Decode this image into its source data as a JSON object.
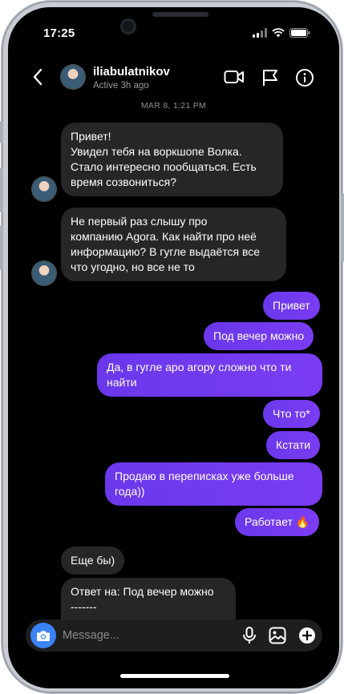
{
  "status_bar": {
    "time": "17:25"
  },
  "header": {
    "username": "iliabulatnikov",
    "activity": "Active 3h ago",
    "icons": [
      "back-icon",
      "video-call-icon",
      "flag-icon",
      "info-icon"
    ]
  },
  "date_stamp": "MAR 8, 1:21 PM",
  "messages": [
    {
      "direction": "incoming",
      "text": "Привет!\nУвидел тебя на воркшопе Волка.\nСтало интересно пообщаться. Есть\nвремя созвониться?"
    },
    {
      "direction": "incoming",
      "text": "Не первый раз слышу про\nкомпанию Agora. Как найти про неё\nинформацию? В гугле выдаётся все\nчто угодно, но все не то"
    },
    {
      "direction": "outgoing",
      "text": "Привет"
    },
    {
      "direction": "outgoing",
      "text": "Под вечер можно"
    },
    {
      "direction": "outgoing",
      "text": "Да, в гугле аро агору сложно что ти\nнайти"
    },
    {
      "direction": "outgoing",
      "text": "Что то*"
    },
    {
      "direction": "outgoing",
      "text": "Кстати"
    },
    {
      "direction": "outgoing",
      "text": "Продаю в переписках уже больше\nгода))"
    },
    {
      "direction": "outgoing",
      "text": "Работает 🔥"
    },
    {
      "direction": "incoming",
      "text": "Еще бы)"
    },
    {
      "direction": "incoming",
      "text": "Ответ на: Под вечер можно\n-------"
    }
  ],
  "composer": {
    "placeholder": "Message...",
    "icons": [
      "camera-icon",
      "microphone-icon",
      "gallery-icon",
      "add-icon"
    ]
  },
  "colors": {
    "background": "#000000",
    "incoming_bubble": "#262626",
    "outgoing_bubble": "#6a38ea",
    "camera_button": "#3b82f6",
    "secondary_text": "#8e8e8e"
  }
}
